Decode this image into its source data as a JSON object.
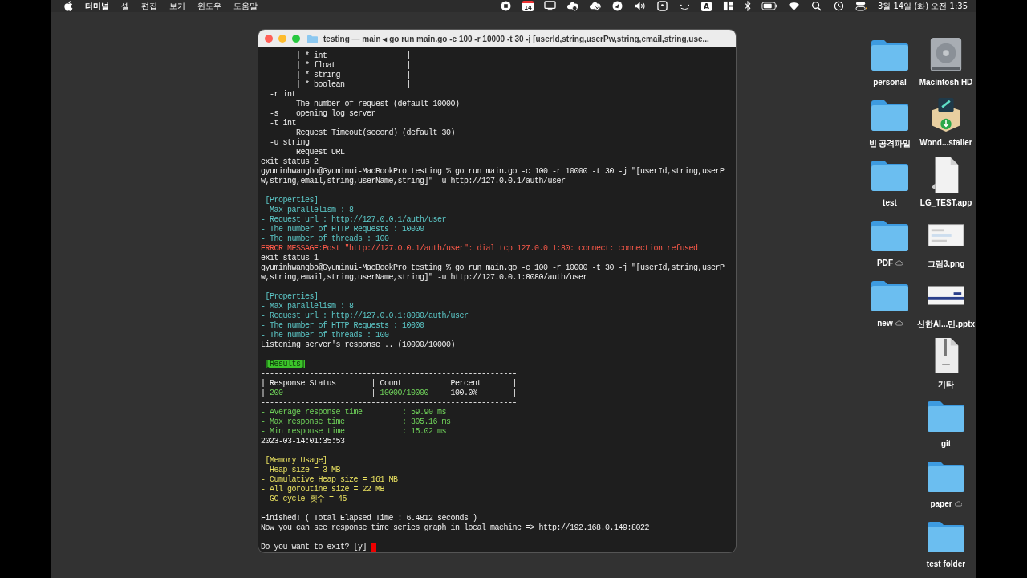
{
  "menu_bar": {
    "app_name": "터미널",
    "menus": [
      "셸",
      "편집",
      "보기",
      "윈도우",
      "도움말"
    ],
    "calendar_day": "14",
    "input_source": "A",
    "clock": "3월 14일 (화) 오전 1:35"
  },
  "terminal": {
    "title": "testing — main ◂ go run main.go -c 100 -r 10000 -t 30 -j [userId,string,userPw,string,email,string,use...",
    "lines": [
      {
        "kind": "text",
        "segments": [
          {
            "text": "        | * int                  |",
            "kind": "plain"
          }
        ]
      },
      {
        "kind": "text",
        "segments": [
          {
            "text": "        | * float                |",
            "kind": "plain"
          }
        ]
      },
      {
        "kind": "text",
        "segments": [
          {
            "text": "        | * string               |",
            "kind": "plain"
          }
        ]
      },
      {
        "kind": "text",
        "segments": [
          {
            "text": "        | * boolean              |",
            "kind": "plain"
          }
        ]
      },
      {
        "kind": "text",
        "segments": [
          {
            "text": "  -r int",
            "kind": "plain"
          }
        ]
      },
      {
        "kind": "text",
        "segments": [
          {
            "text": "        The number of request (default 10000)",
            "kind": "plain"
          }
        ]
      },
      {
        "kind": "text",
        "segments": [
          {
            "text": "  -s    opening log server",
            "kind": "plain"
          }
        ]
      },
      {
        "kind": "text",
        "segments": [
          {
            "text": "  -t int",
            "kind": "plain"
          }
        ]
      },
      {
        "kind": "text",
        "segments": [
          {
            "text": "        Request Timeout(second) (default 30)",
            "kind": "plain"
          }
        ]
      },
      {
        "kind": "text",
        "segments": [
          {
            "text": "  -u string",
            "kind": "plain"
          }
        ]
      },
      {
        "kind": "text",
        "segments": [
          {
            "text": "        Request URL",
            "kind": "plain"
          }
        ]
      },
      {
        "kind": "text",
        "segments": [
          {
            "text": "exit status 2",
            "kind": "plain"
          }
        ]
      },
      {
        "kind": "text",
        "segments": [
          {
            "text": "gyuminhwangbo@Gyuminui-MacBookPro testing % go run main.go -c 100 -r 10000 -t 30 -j \"[userId,string,userP",
            "kind": "plain"
          }
        ]
      },
      {
        "kind": "text",
        "segments": [
          {
            "text": "w,string,email,string,userName,string]\" -u http://127.0.0.1/auth/user",
            "kind": "plain"
          }
        ]
      },
      {
        "kind": "blank"
      },
      {
        "kind": "text",
        "segments": [
          {
            "text": " [Properties]",
            "kind": "info"
          }
        ]
      },
      {
        "kind": "text",
        "segments": [
          {
            "text": "- Max parallelism : 8",
            "kind": "info"
          }
        ]
      },
      {
        "kind": "text",
        "segments": [
          {
            "text": "- Request url : http://127.0.0.1/auth/user",
            "kind": "info"
          }
        ]
      },
      {
        "kind": "text",
        "segments": [
          {
            "text": "- The number of HTTP Requests : 10000",
            "kind": "info"
          }
        ]
      },
      {
        "kind": "text",
        "segments": [
          {
            "text": "- The number of threads : 100",
            "kind": "info"
          }
        ]
      },
      {
        "kind": "text",
        "segments": [
          {
            "text": "ERROR MESSAGE:Post \"http://127.0.0.1/auth/user\": dial tcp 127.0.0.1:80: connect: connection refused",
            "kind": "error"
          }
        ]
      },
      {
        "kind": "text",
        "segments": [
          {
            "text": "exit status 1",
            "kind": "plain"
          }
        ]
      },
      {
        "kind": "text",
        "segments": [
          {
            "text": "gyuminhwangbo@Gyuminui-MacBookPro testing % go run main.go -c 100 -r 10000 -t 30 -j \"[userId,string,userP",
            "kind": "plain"
          }
        ]
      },
      {
        "kind": "text",
        "segments": [
          {
            "text": "w,string,email,string,userName,string]\" -u http://127.0.0.1:8080/auth/user",
            "kind": "plain"
          }
        ]
      },
      {
        "kind": "blank"
      },
      {
        "kind": "text",
        "segments": [
          {
            "text": " [Properties]",
            "kind": "info"
          }
        ]
      },
      {
        "kind": "text",
        "segments": [
          {
            "text": "- Max parallelism : 8",
            "kind": "info"
          }
        ]
      },
      {
        "kind": "text",
        "segments": [
          {
            "text": "- Request url : http://127.0.0.1:8080/auth/user",
            "kind": "info"
          }
        ]
      },
      {
        "kind": "text",
        "segments": [
          {
            "text": "- The number of HTTP Requests : 10000",
            "kind": "info"
          }
        ]
      },
      {
        "kind": "text",
        "segments": [
          {
            "text": "- The number of threads : 100",
            "kind": "info"
          }
        ]
      },
      {
        "kind": "text",
        "segments": [
          {
            "text": "Listening server's response .. (10000/10000)",
            "kind": "plain"
          }
        ]
      },
      {
        "kind": "blank"
      },
      {
        "kind": "text",
        "segments": [
          {
            "text": "[Results]",
            "kind": "selected"
          }
        ]
      },
      {
        "kind": "text",
        "segments": [
          {
            "text": "----------------------------------------------------------",
            "kind": "plain"
          }
        ]
      },
      {
        "kind": "text",
        "segments": [
          {
            "text": "| Response Status        | Count         | Percent       |",
            "kind": "plain"
          }
        ]
      },
      {
        "kind": "text",
        "segments": [
          {
            "text": "| ",
            "kind": "plain"
          },
          {
            "text": "200",
            "kind": "success"
          },
          {
            "text": "                    | ",
            "kind": "plain"
          },
          {
            "text": "10000/10000",
            "kind": "success"
          },
          {
            "text": "   | 100.0%        |",
            "kind": "plain"
          }
        ]
      },
      {
        "kind": "text",
        "segments": [
          {
            "text": "----------------------------------------------------------",
            "kind": "plain"
          }
        ]
      },
      {
        "kind": "text",
        "segments": [
          {
            "text": "- Average response time         : 59.90 ms",
            "kind": "success"
          }
        ]
      },
      {
        "kind": "text",
        "segments": [
          {
            "text": "- Max response time             : 305.16 ms",
            "kind": "success"
          }
        ]
      },
      {
        "kind": "text",
        "segments": [
          {
            "text": "- Min response time             : 15.02 ms",
            "kind": "success"
          }
        ]
      },
      {
        "kind": "text",
        "segments": [
          {
            "text": "2023-03-14:01:35:53",
            "kind": "plain"
          }
        ]
      },
      {
        "kind": "blank"
      },
      {
        "kind": "text",
        "segments": [
          {
            "text": " [Memory Usage]",
            "kind": "warning"
          }
        ]
      },
      {
        "kind": "text",
        "segments": [
          {
            "text": "- Heap size = 3 MB",
            "kind": "warning"
          }
        ]
      },
      {
        "kind": "text",
        "segments": [
          {
            "text": "- Cumulative Heap size = 161 MB",
            "kind": "warning"
          }
        ]
      },
      {
        "kind": "text",
        "segments": [
          {
            "text": "- All goroutine size = 22 MB",
            "kind": "warning"
          }
        ]
      },
      {
        "kind": "text",
        "segments": [
          {
            "text": "- GC cycle 횟수 = 45",
            "kind": "warning"
          }
        ]
      },
      {
        "kind": "blank"
      },
      {
        "kind": "text",
        "segments": [
          {
            "text": "Finished! ( Total Elapsed Time : 6.4812 seconds )",
            "kind": "plain"
          }
        ]
      },
      {
        "kind": "text",
        "segments": [
          {
            "text": "Now you can see response time series graph in local machine => http://192.168.0.149:8022",
            "kind": "plain"
          }
        ]
      },
      {
        "kind": "blank"
      },
      {
        "kind": "prompt",
        "segments": [
          {
            "text": "Do you want to exit? [y] ",
            "kind": "plain"
          }
        ]
      }
    ]
  },
  "desktop": {
    "columns": [
      [
        {
          "label": "personal",
          "kind": "folder",
          "cloud": false
        },
        {
          "label": "빈 공격파일",
          "kind": "folder",
          "cloud": false
        },
        {
          "label": "test",
          "kind": "folder",
          "cloud": false
        },
        {
          "label": "PDF",
          "kind": "folder",
          "cloud": true
        },
        {
          "label": "new",
          "kind": "folder",
          "cloud": true
        }
      ],
      [
        {
          "label": "Macintosh HD",
          "kind": "drive",
          "cloud": false
        },
        {
          "label": "Wond...staller",
          "kind": "installer",
          "cloud": false
        },
        {
          "label": "LG_TEST.app",
          "kind": "document",
          "cloud": false
        },
        {
          "label": "그림3.png",
          "kind": "image",
          "cloud": false
        },
        {
          "label": "신한AI...민.pptx",
          "kind": "slides",
          "cloud": false
        },
        {
          "label": "기타",
          "kind": "zip",
          "cloud": false
        },
        {
          "label": "git",
          "kind": "folder",
          "cloud": false
        },
        {
          "label": "paper",
          "kind": "folder",
          "cloud": true
        },
        {
          "label": "test folder",
          "kind": "folder",
          "cloud": false
        }
      ]
    ]
  }
}
